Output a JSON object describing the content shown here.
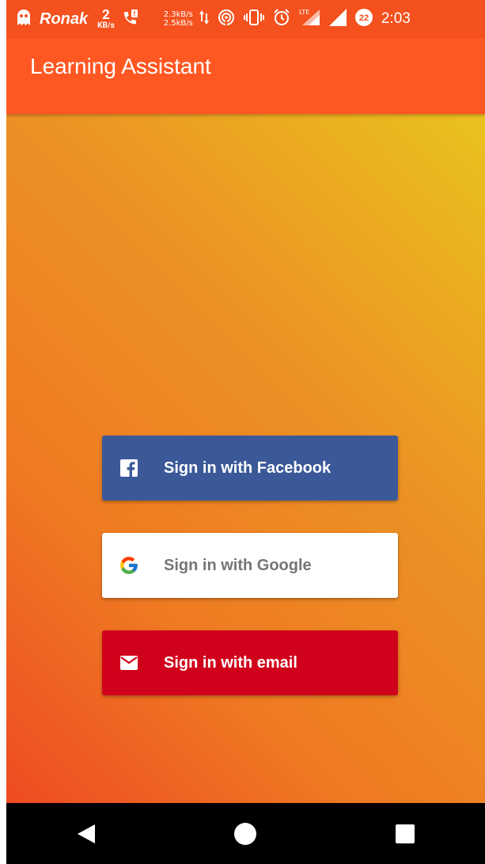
{
  "status_bar": {
    "carrier": "Ronak",
    "network_rate": "2",
    "network_unit": "KB/s",
    "upload_speed": "2.3kB/s",
    "download_speed": "2.5kB/s",
    "network_type": "LTE",
    "badge_count": "22",
    "time": "2:03"
  },
  "app_bar": {
    "title": "Learning Assistant"
  },
  "signin": {
    "facebook_label": "Sign in with Facebook",
    "google_label": "Sign in with Google",
    "email_label": "Sign in with email"
  },
  "colors": {
    "status_bar_bg": "#f4511e",
    "app_bar_bg": "#ff5722",
    "facebook_bg": "#3b5998",
    "google_bg": "#ffffff",
    "email_bg": "#d0021b",
    "nav_bar_bg": "#000000"
  },
  "nav_bar": {
    "icons": [
      "back-icon",
      "home-icon",
      "recents-icon"
    ]
  }
}
